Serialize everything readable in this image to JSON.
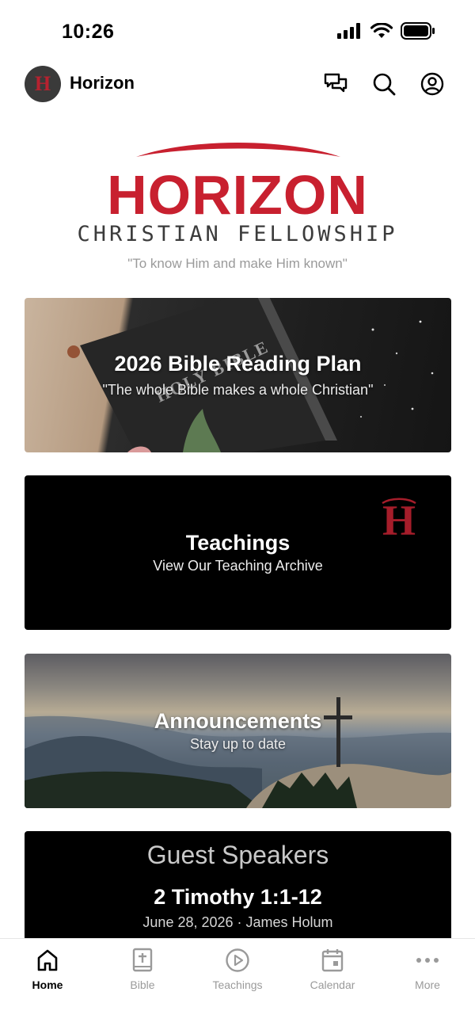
{
  "status": {
    "time": "10:26"
  },
  "header": {
    "title": "Horizon",
    "avatar_letter": "H"
  },
  "logo": {
    "word": "HORIZON",
    "subtitle": "CHRISTIAN FELLOWSHIP",
    "tagline": "\"To know Him and make Him known\""
  },
  "cards": {
    "bible_plan": {
      "title": "2026 Bible Reading Plan",
      "subtitle": "\"The whole Bible makes a whole Christian\"",
      "book_text": "HOLY BIBLE"
    },
    "teachings": {
      "title": "Teachings",
      "subtitle": "View Our Teaching Archive",
      "logo_letter": "H"
    },
    "announcements": {
      "title": "Announcements",
      "subtitle": "Stay up to date"
    },
    "guest": {
      "heading": "Guest Speakers",
      "title": "2 Timothy 1:1-12",
      "subtitle": "June 28, 2026 · James Holum"
    }
  },
  "nav": {
    "items": [
      {
        "label": "Home",
        "icon": "home-icon",
        "active": true
      },
      {
        "label": "Bible",
        "icon": "bible-icon",
        "active": false
      },
      {
        "label": "Teachings",
        "icon": "play-circle-icon",
        "active": false
      },
      {
        "label": "Calendar",
        "icon": "calendar-icon",
        "active": false
      },
      {
        "label": "More",
        "icon": "more-icon",
        "active": false
      }
    ]
  },
  "colors": {
    "brand_red": "#c8202f",
    "nav_active": "#000000",
    "nav_inactive": "#9a9a9a"
  }
}
